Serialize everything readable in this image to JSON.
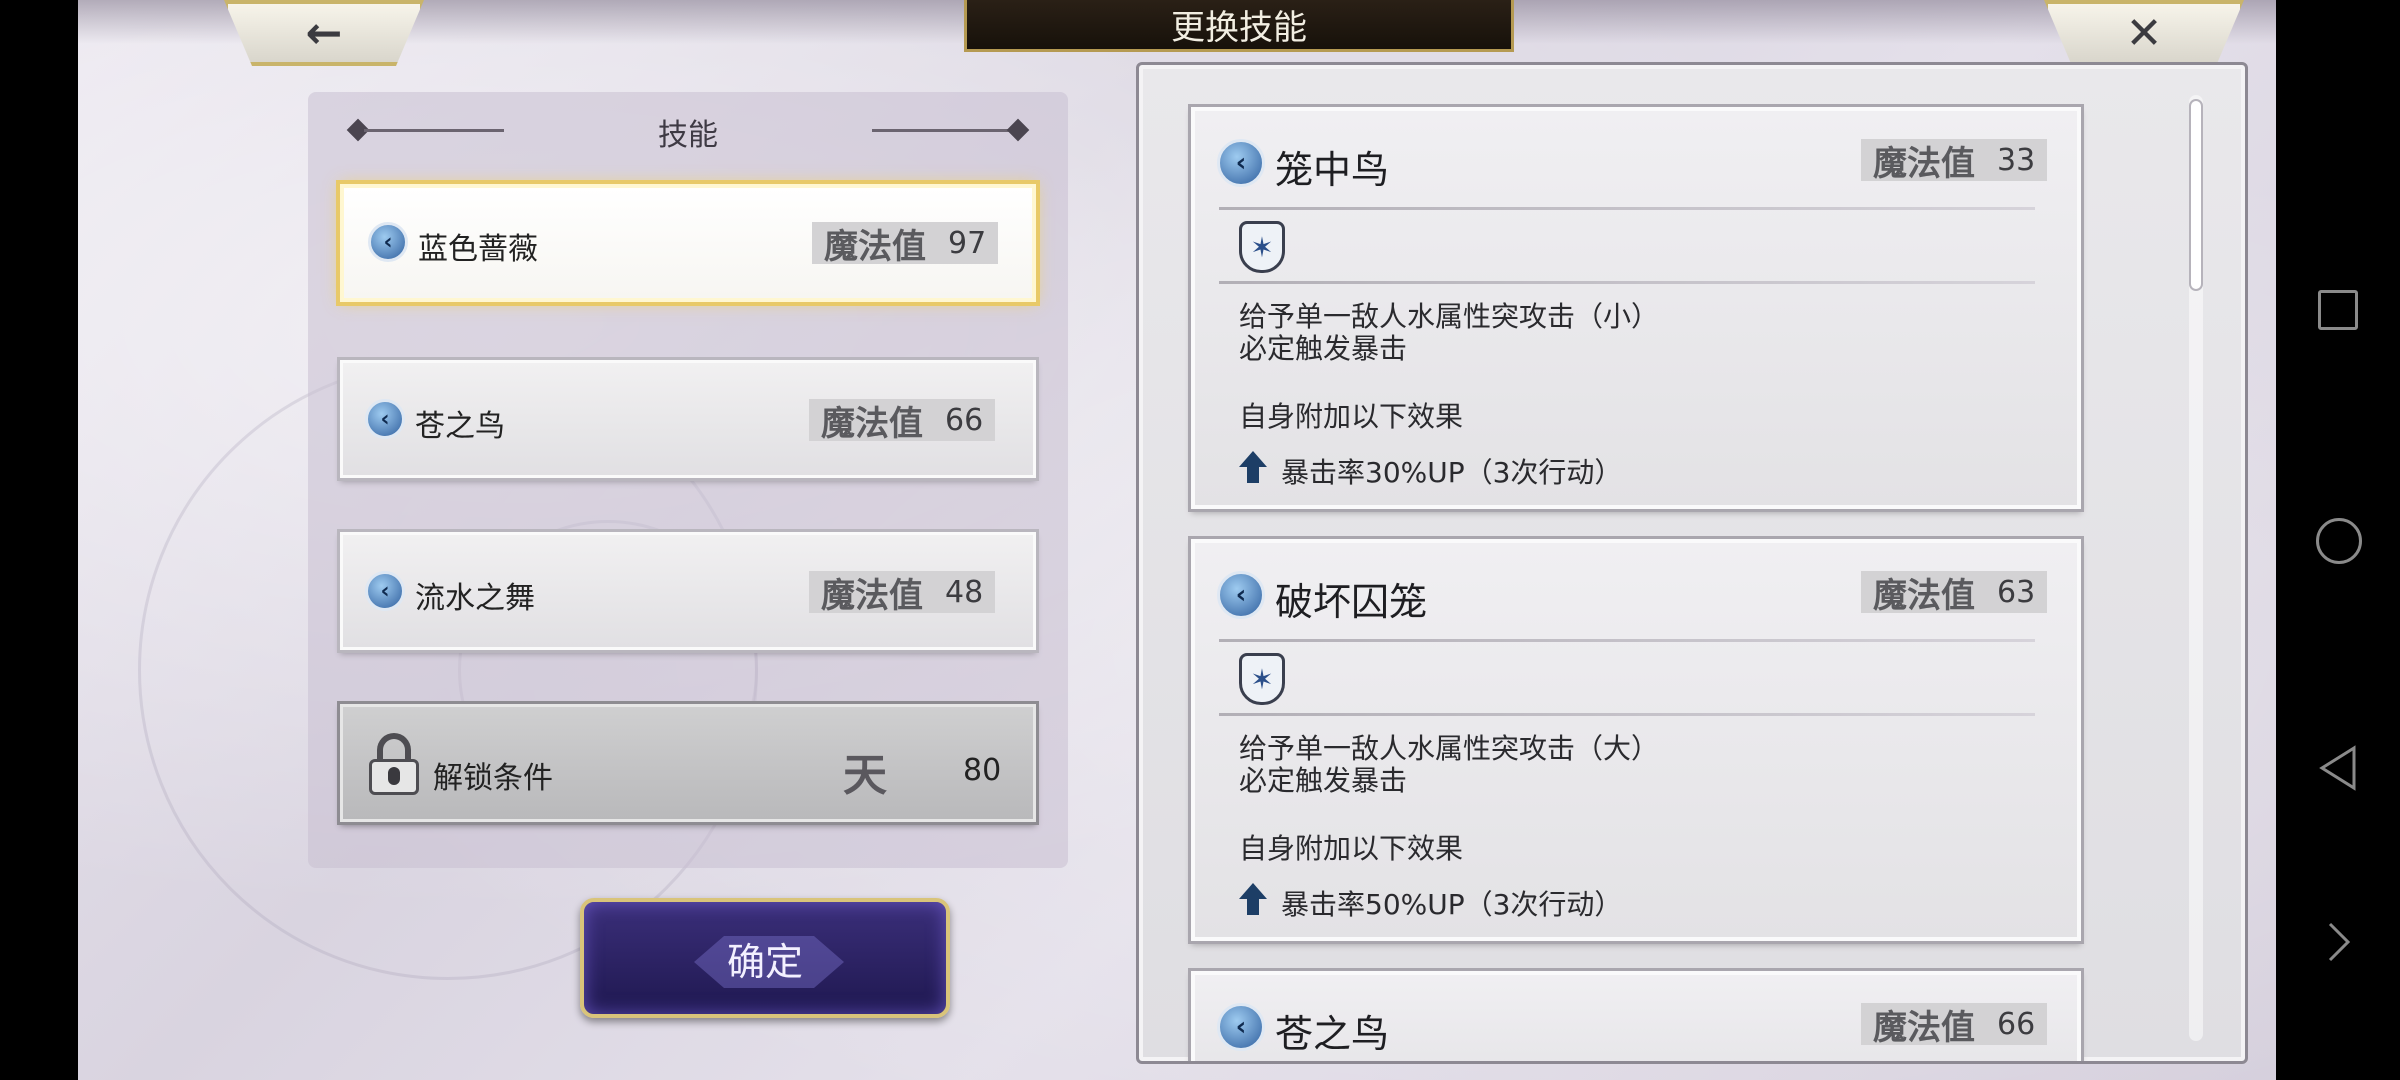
{
  "header": {
    "title": "更换技能",
    "back_label": "←",
    "close_label": "✕"
  },
  "left_panel": {
    "title": "技能",
    "skills": [
      {
        "name": "蓝色蔷薇",
        "mp_label": "魔法值",
        "mp": "97",
        "selected": true
      },
      {
        "name": "苍之鸟",
        "mp_label": "魔法值",
        "mp": "66"
      },
      {
        "name": "流水之舞",
        "mp_label": "魔法值",
        "mp": "48"
      }
    ],
    "locked": {
      "label": "解锁条件",
      "rank_glyph": "天",
      "value": "80"
    },
    "confirm_label": "确定"
  },
  "right_panel": {
    "cards": [
      {
        "name": "笼中鸟",
        "mp_label": "魔法值",
        "mp": "33",
        "desc_line1": "给予单一敌人水属性突攻击（小）",
        "desc_line2": "必定触发暴击",
        "self_effect_title": "自身附加以下效果",
        "effect": "暴击率30%UP（3次行动）"
      },
      {
        "name": "破坏囚笼",
        "mp_label": "魔法值",
        "mp": "63",
        "desc_line1": "给予单一敌人水属性突攻击（大）",
        "desc_line2": "必定触发暴击",
        "self_effect_title": "自身附加以下效果",
        "effect": "暴击率50%UP（3次行动）"
      },
      {
        "name": "苍之鸟",
        "mp_label": "魔法值",
        "mp": "66"
      }
    ]
  },
  "icons": {
    "skill_type": "blue-arrow-orb-icon",
    "element": "water-splash-icon",
    "buff": "up-arrow-icon",
    "lock": "padlock-icon"
  },
  "colors": {
    "selected_border": "#e8c968",
    "confirm_bg": "#2b2262",
    "gold_trim": "#c9b46a"
  }
}
